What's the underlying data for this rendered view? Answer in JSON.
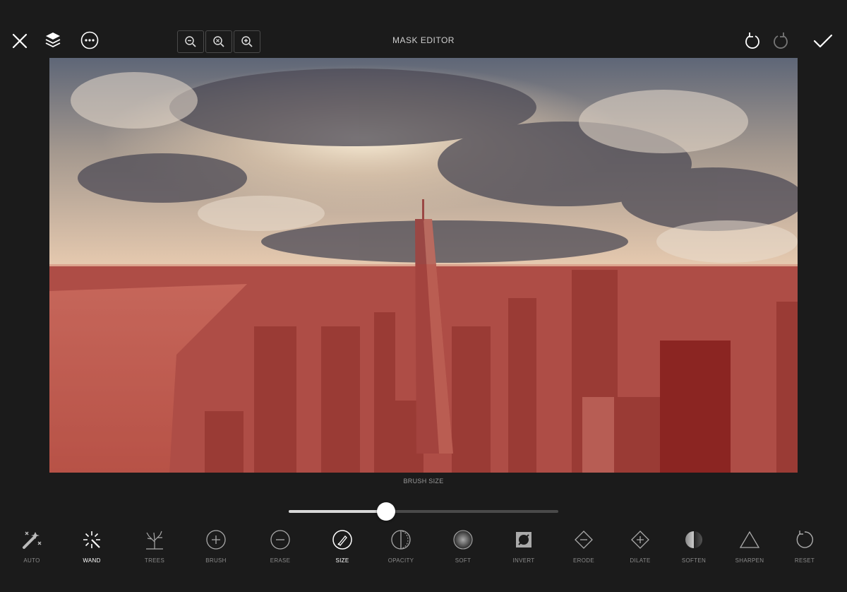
{
  "header": {
    "title": "MASK EDITOR",
    "left_icons": [
      "close-icon",
      "layers-icon",
      "more-icon"
    ],
    "zoom_icons": [
      "zoom-out-icon",
      "zoom-fit-icon",
      "zoom-in-icon"
    ],
    "right_icons": [
      "undo-icon",
      "redo-icon",
      "checkmark-icon"
    ]
  },
  "canvas": {
    "image": "aerial photo of a city skyline under a cloudy sky with a red mask overlay",
    "mask_color": "#c0392b"
  },
  "brush": {
    "label": "BRUSH SIZE",
    "value_fraction": 0.36
  },
  "tools": [
    {
      "label": "AUTO",
      "icon": "magic-wand-auto-icon",
      "active": false
    },
    {
      "label": "WAND",
      "icon": "magic-wand-sparkle-icon",
      "active": true
    },
    {
      "label": "TREES",
      "icon": "tree-icon",
      "active": false
    },
    {
      "label": "BRUSH",
      "icon": "plus-circle-icon",
      "active": false
    },
    {
      "label": "ERASE",
      "icon": "minus-circle-icon",
      "active": false
    },
    {
      "label": "SIZE",
      "icon": "brush-circle-icon",
      "active": true
    },
    {
      "label": "OPACITY",
      "icon": "half-circle-icon",
      "active": false
    },
    {
      "label": "SOFT",
      "icon": "soft-circle-icon",
      "active": false
    },
    {
      "label": "INVERT",
      "icon": "invert-square-icon",
      "active": false
    },
    {
      "label": "ERODE",
      "icon": "diamond-minus-icon",
      "active": false
    },
    {
      "label": "DILATE",
      "icon": "diamond-plus-icon",
      "active": false
    },
    {
      "label": "SOFTEN",
      "icon": "gradient-circle-icon",
      "active": false
    },
    {
      "label": "SHARPEN",
      "icon": "triangle-icon",
      "active": false
    },
    {
      "label": "RESET",
      "icon": "reset-icon",
      "active": false
    }
  ]
}
